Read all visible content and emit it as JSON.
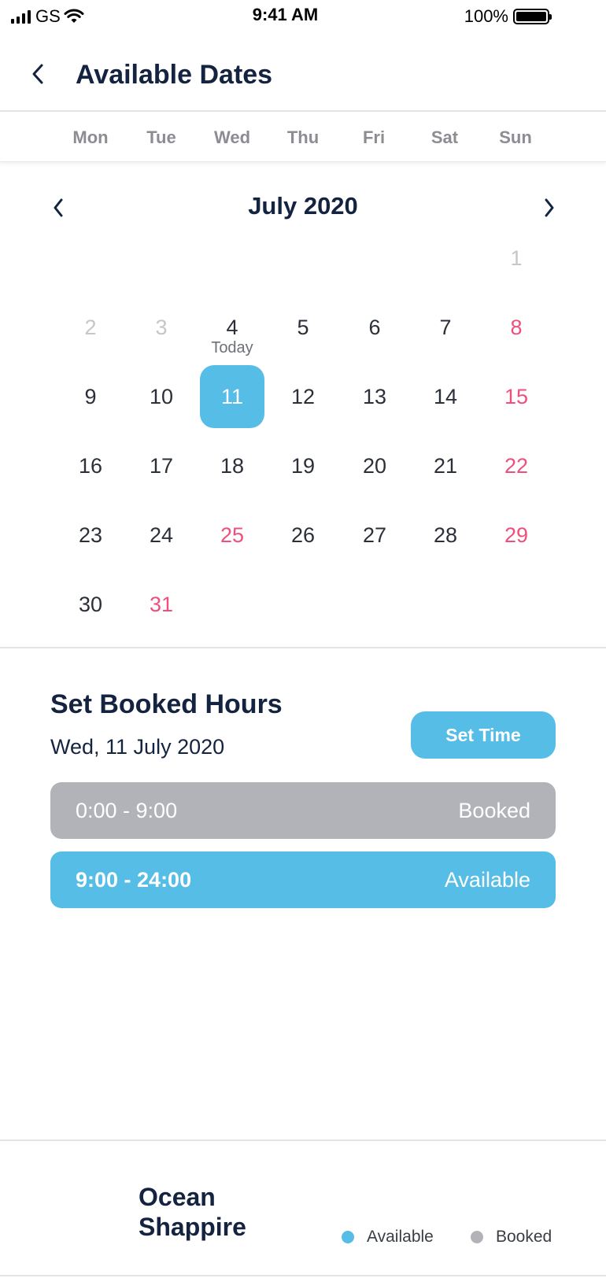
{
  "status_bar": {
    "carrier": "GS",
    "time": "9:41 AM",
    "battery": "100%"
  },
  "header": {
    "title": "Available Dates"
  },
  "weekdays": [
    "Mon",
    "Tue",
    "Wed",
    "Thu",
    "Fri",
    "Sat",
    "Sun"
  ],
  "calendar": {
    "month_title": "July 2020",
    "today_label": "Today",
    "days": [
      "1",
      "2",
      "3",
      "4",
      "5",
      "6",
      "7",
      "8",
      "9",
      "10",
      "11",
      "12",
      "13",
      "14",
      "15",
      "16",
      "17",
      "18",
      "19",
      "20",
      "21",
      "22",
      "23",
      "24",
      "25",
      "26",
      "27",
      "28",
      "29",
      "30",
      "31"
    ],
    "selected_day": "11",
    "today_day": "4",
    "unavailable_days": [
      "1",
      "2",
      "3"
    ],
    "highlighted_days": [
      "8",
      "15",
      "22",
      "25",
      "29",
      "31"
    ]
  },
  "booking": {
    "section_title": "Set Booked Hours",
    "selected_date": "Wed, 11 July 2020",
    "set_time_label": "Set Time",
    "slots": [
      {
        "range": "0:00 - 9:00",
        "status": "Booked"
      },
      {
        "range": "9:00 - 24:00",
        "status": "Available"
      }
    ]
  },
  "footer": {
    "brand_line1": "Ocean",
    "brand_line2": "Shappire",
    "legend_available": "Available",
    "legend_booked": "Booked"
  },
  "colors": {
    "accent": "#56bde6",
    "booked": "#b1b3b8",
    "highlight": "#ef4f7c",
    "title": "#142340"
  }
}
